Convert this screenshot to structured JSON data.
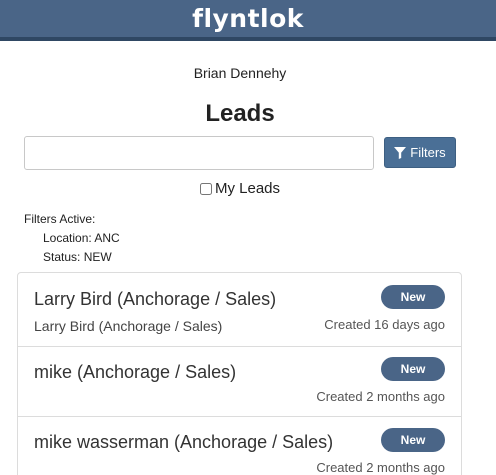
{
  "header": {
    "logo_text": "flyntlok",
    "brand_color": "#4a6587"
  },
  "user": {
    "name": "Brian Dennehy"
  },
  "page": {
    "title": "Leads"
  },
  "search": {
    "value": "",
    "placeholder": ""
  },
  "filters_button": {
    "label": "Filters",
    "icon": "filter-icon"
  },
  "my_leads": {
    "label": "My Leads",
    "checked": false
  },
  "filters_active": {
    "heading": "Filters Active:",
    "items": [
      "Location: ANC",
      "Status: NEW"
    ]
  },
  "leads": [
    {
      "name": "Larry Bird (Anchorage / Sales)",
      "subtitle": "Larry Bird (Anchorage / Sales)",
      "status": "New",
      "created": "Created 16 days ago"
    },
    {
      "name": "mike (Anchorage / Sales)",
      "subtitle": "",
      "status": "New",
      "created": "Created 2 months ago"
    },
    {
      "name": "mike wasserman (Anchorage / Sales)",
      "subtitle": "",
      "status": "New",
      "created": "Created 2 months ago"
    }
  ]
}
